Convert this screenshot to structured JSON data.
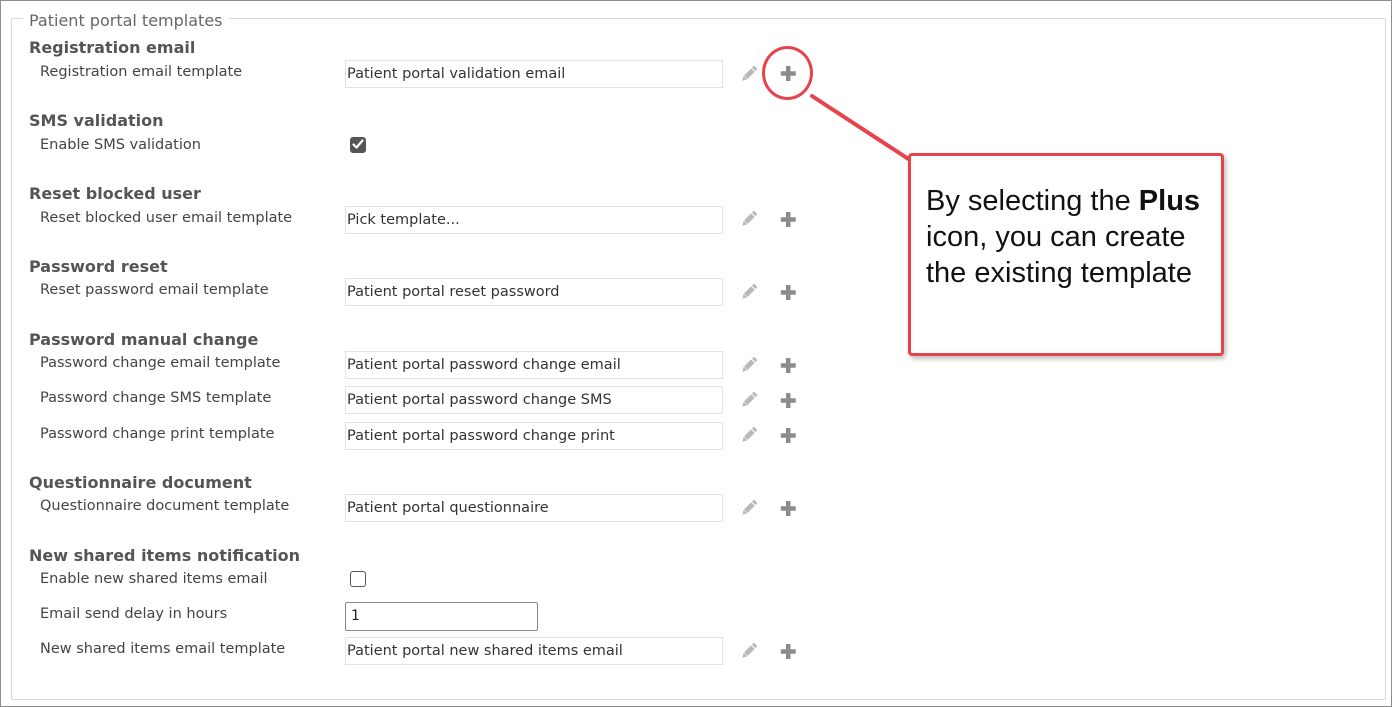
{
  "fieldset": {
    "legend": "Patient portal templates"
  },
  "sections": {
    "registration": {
      "title": "Registration email",
      "template_label": "Registration email template",
      "template_value": "Patient portal validation email"
    },
    "sms_validation": {
      "title": "SMS validation",
      "enable_label": "Enable SMS validation",
      "enabled": true
    },
    "reset_blocked": {
      "title": "Reset blocked user",
      "template_label": "Reset blocked user email template",
      "template_value": "Pick template..."
    },
    "password_reset": {
      "title": "Password reset",
      "template_label": "Reset password email template",
      "template_value": "Patient portal reset password"
    },
    "password_manual": {
      "title": "Password manual change",
      "email_label": "Password change email template",
      "email_value": "Patient portal password change email",
      "sms_label": "Password change SMS template",
      "sms_value": "Patient portal password change SMS",
      "print_label": "Password change print template",
      "print_value": "Patient portal password change print"
    },
    "questionnaire": {
      "title": "Questionnaire document",
      "template_label": "Questionnaire document template",
      "template_value": "Patient portal questionnaire"
    },
    "shared_items": {
      "title": "New shared items notification",
      "enable_label": "Enable new shared items email",
      "enabled": false,
      "delay_label": "Email send delay in hours",
      "delay_value": "1",
      "template_label": "New shared items email template",
      "template_value": "Patient portal new shared items email"
    }
  },
  "icons": {
    "edit": "pencil-icon",
    "add": "plus-icon"
  },
  "callout": {
    "text_before": "By selecting the ",
    "text_bold": "Plus",
    "text_after": " icon, you can create the existing template",
    "color": "#e8434d"
  }
}
